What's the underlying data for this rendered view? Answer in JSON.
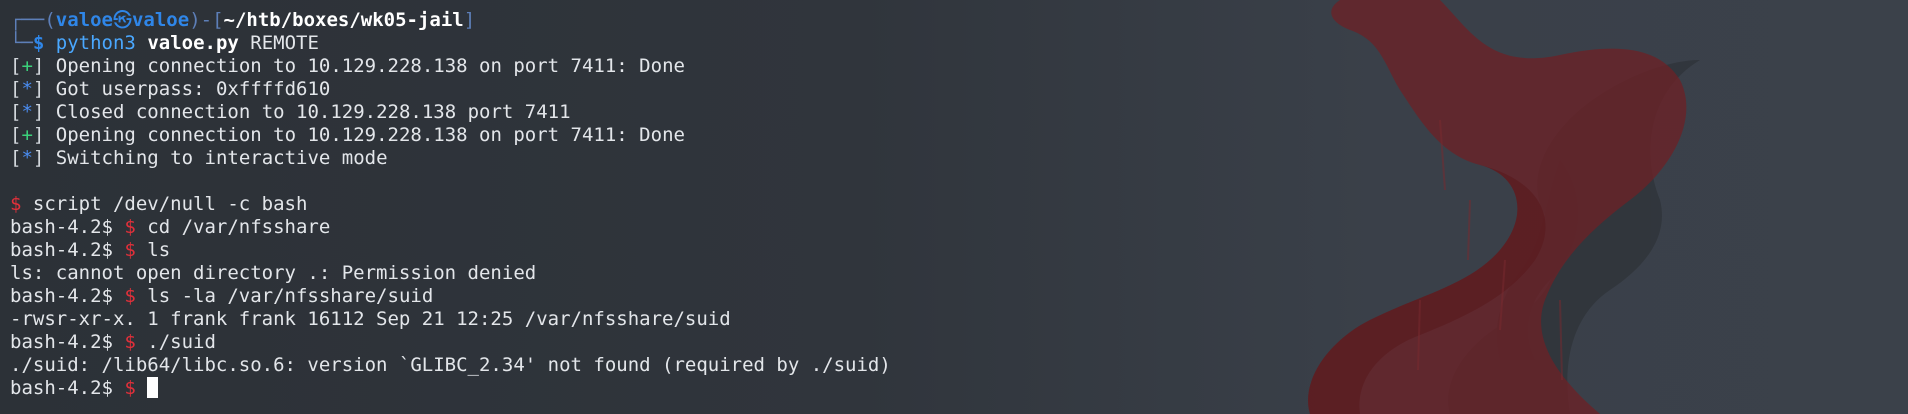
{
  "prompt": {
    "open": "┌──(",
    "user": "valoe",
    "at": "㉿",
    "host": "valoe",
    "mid": ")-[",
    "path": "~/htb/boxes/wk05-jail",
    "close": "]",
    "corner": "└─",
    "dollar": "$"
  },
  "command": {
    "program": "python3",
    "file": "valoe.py",
    "arg": " REMOTE"
  },
  "output": [
    {
      "marker": "+",
      "text": " Opening connection to 10.129.228.138 on port 7411: Done"
    },
    {
      "marker": "*",
      "text": " Got userpass: 0xffffd610"
    },
    {
      "marker": "*",
      "text": " Closed connection to 10.129.228.138 port 7411"
    },
    {
      "marker": "+",
      "text": " Opening connection to 10.129.228.138 on port 7411: Done"
    },
    {
      "marker": "*",
      "text": " Switching to interactive mode"
    }
  ],
  "shell": {
    "dollar": "$",
    "prompt": "bash-4.2$ ",
    "script_cmd": " script /dev/null -c bash",
    "cmd1": " cd /var/nfsshare",
    "cmd2": " ls",
    "out2": "ls: cannot open directory .: Permission denied",
    "cmd3": " ls -la /var/nfsshare/suid",
    "out3": "-rwsr-xr-x. 1 frank frank 16112 Sep 21 12:25 /var/nfsshare/suid",
    "cmd4": " ./suid",
    "out4": "./suid: /lib64/libc.so.6: version `GLIBC_2.34' not found (required by ./suid)"
  },
  "colors": {
    "background": "#30353b",
    "prompt_blue": "#2f86e8",
    "dollar_red": "#e0303a",
    "plus_green": "#3bd17a",
    "star_blue": "#4a8cf0",
    "wallpaper_red": "#6b2126"
  },
  "icons": {
    "wallpaper": "fox-silhouette-wallpaper",
    "cursor": "block-cursor"
  }
}
